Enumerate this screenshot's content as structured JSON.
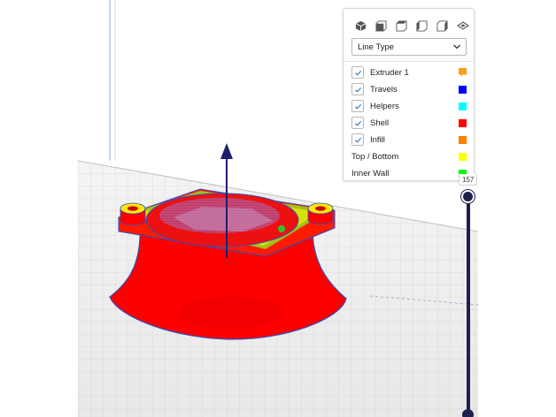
{
  "view_buttons": [
    {
      "name": "view-3d-button",
      "icon": "cube-3d-icon"
    },
    {
      "name": "view-front-button",
      "icon": "cube-front-icon"
    },
    {
      "name": "view-top-button",
      "icon": "cube-top-icon"
    },
    {
      "name": "view-left-button",
      "icon": "cube-left-icon"
    },
    {
      "name": "view-right-button",
      "icon": "cube-right-icon"
    },
    {
      "name": "view-xray-button",
      "icon": "layers-icon"
    }
  ],
  "color_scheme": {
    "selected": "Line Type"
  },
  "legend": {
    "items": [
      {
        "label": "Extruder 1",
        "checked": true,
        "color": "#f7a11c",
        "shape": "flag"
      },
      {
        "label": "Travels",
        "checked": true,
        "color": "#0000ff",
        "shape": "square"
      },
      {
        "label": "Helpers",
        "checked": true,
        "color": "#00ffff",
        "shape": "square"
      },
      {
        "label": "Shell",
        "checked": true,
        "color": "#ff0000",
        "shape": "square"
      },
      {
        "label": "Infill",
        "checked": true,
        "color": "#ff8000",
        "shape": "square"
      },
      {
        "label": "Top / Bottom",
        "checked": false,
        "color": "#ffff00",
        "shape": "square"
      },
      {
        "label": "Inner Wall",
        "checked": false,
        "color": "#00ff00",
        "shape": "square"
      }
    ]
  },
  "layer_slider": {
    "value": "157"
  },
  "colors": {
    "accent": "#1f1f4d",
    "check": "#3a7fd0"
  }
}
